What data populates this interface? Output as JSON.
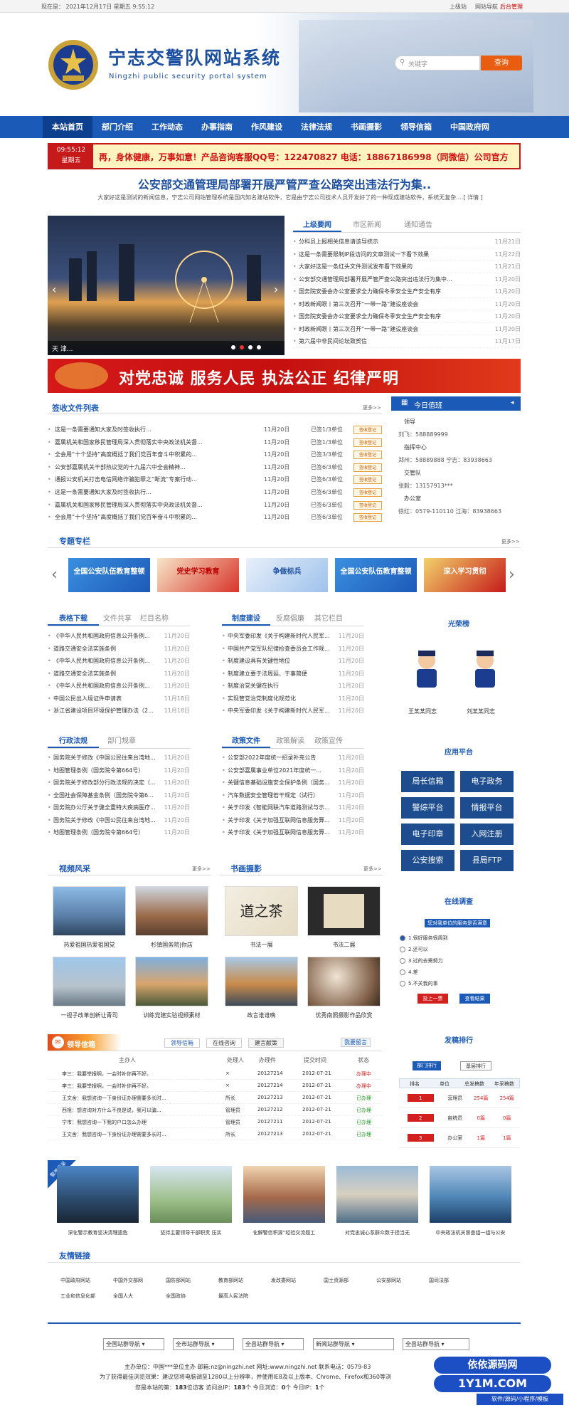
{
  "topbar": {
    "date": "现在是： 2021年12月17日 星期五 9:55:12",
    "links": [
      "上级站",
      "网站导航",
      "后台管理"
    ]
  },
  "header": {
    "title": "宁志交警队网站系统",
    "subtitle": "Ningzhi public security portal system",
    "search_placeholder": "关键字",
    "search_button": "查询"
  },
  "nav": [
    "本站首页",
    "部门介绍",
    "工作动态",
    "办事指南",
    "作风建设",
    "法律法规",
    "书画摄影",
    "领导信箱",
    "中国政府网"
  ],
  "clock": {
    "time": "09:55:12",
    "weekday": "星期五"
  },
  "marquee": "再，身体健康，万事如意！产品咨询客服QQ号：122470827 电话：18867186998（同微信）公司官方",
  "headline": {
    "title": "公安部交通管理局部署开展严管严查公路突出违法行为集..",
    "summary": "大家好这是测试的新闻信息，宁志公司网站管理系统是国内知名建站软件，它是由宁志公司技术人员开发好了的一种现成建站软件，系统无复杂....[ 详情 ]"
  },
  "slider": {
    "caption": "天 津..."
  },
  "news": {
    "tabs": [
      "上级要闻",
      "市区新闻",
      "通知通告"
    ],
    "items": [
      {
        "t": "分科员上报相关信息请该导统示",
        "d": "11月21日"
      },
      {
        "t": "这是一条需要限制IP段访问的文章测试一下看下效果",
        "d": "11月22日"
      },
      {
        "t": "大家好这是一条红头文件测试发布看下效果的",
        "d": "11月21日"
      },
      {
        "t": "公安部交通管理局部署开展严管严查公路突出违法行为集中...",
        "d": "11月20日"
      },
      {
        "t": "国务院安委会办公室要求全力确保冬季安全生产安全有序",
        "d": "11月20日"
      },
      {
        "t": "时政新闻眼丨第三次召开“一带一路”建设座谈会",
        "d": "11月20日"
      },
      {
        "t": "国务院安委会办公室要求全力确保冬季安全生产安全有序",
        "d": "11月20日"
      },
      {
        "t": "时政新闻眼丨第三次召开“一带一路”建设座谈会",
        "d": "11月20日"
      },
      {
        "t": "第六届中非民间论坛致贺信",
        "d": "11月17日"
      }
    ]
  },
  "banner": "对党忠诚  服务人民  执法公正  纪律严明",
  "sign": {
    "title": "签收文件列表",
    "more": "更多>>",
    "items": [
      {
        "t": "这是一条需要通知大家及时签收执行...",
        "d": "11月20日",
        "s": "已签1/3单位",
        "b": "签收登记"
      },
      {
        "t": "嘉属机关和国家移民管理局深入贯彻落实中央政法机关督...",
        "d": "11月20日",
        "s": "已签1/3单位",
        "b": "签收登记"
      },
      {
        "t": "全会用“十个坚持”高度概括了我们党百年奋斗中积累的...",
        "d": "11月20日",
        "s": "已签3/3单位",
        "b": "签收登记"
      },
      {
        "t": "公安部嘉属机关干部热议党的十九届六中全会精神...",
        "d": "11月20日",
        "s": "已签6/3单位",
        "b": "签收登记"
      },
      {
        "t": "通报公安机关打击电信网络诈骗犯罪之“断流”专案行动...",
        "d": "11月20日",
        "s": "已签6/3单位",
        "b": "签收登记"
      },
      {
        "t": "这是一条需要通知大家及时签收执行...",
        "d": "11月20日",
        "s": "已签6/3单位",
        "b": "签收登记"
      },
      {
        "t": "嘉属机关和国家移民管理局深入贯彻落实中央政法机关督...",
        "d": "11月20日",
        "s": "已签6/3单位",
        "b": "签收登记"
      },
      {
        "t": "全会用“十个坚持”高度概括了我们党百年奋斗中积累的...",
        "d": "11月20日",
        "s": "已签6/3单位",
        "b": "签收登记"
      }
    ]
  },
  "duty": {
    "title": "今日值班",
    "lines": [
      "领导",
      "刘飞：588889999",
      "指挥中心",
      "郑州：58889888  宁志：83938663",
      "交管队",
      "张毅：13157913***",
      "办公室",
      "徐红：0579-110110  江海：83938663"
    ]
  },
  "topics": {
    "title": "专题专栏",
    "more": "更多>>",
    "items": [
      "全国公安队伍教育整顿",
      "党史学习教育",
      "争做标兵",
      "全国公安队伍教育整顿",
      "深入学习贯彻"
    ]
  },
  "forms": {
    "tabs": [
      "表格下载",
      "文件共享",
      "栏目名称"
    ],
    "items": [
      {
        "t": "《中华人民共和国政府信息公开条例...",
        "d": "11月20日"
      },
      {
        "t": "道路交通安全法实施条例",
        "d": "11月20日"
      },
      {
        "t": "《中华人民共和国政府信息公开条例...",
        "d": "11月20日"
      },
      {
        "t": "道路交通安全法实施条例",
        "d": "11月20日"
      },
      {
        "t": "《中华人民共和国政府信息公开条例...",
        "d": "11月20日"
      },
      {
        "t": "中国公民出入境证件申请表",
        "d": "11月18日"
      },
      {
        "t": "浙江省建设项目环境保护管理办法（2...",
        "d": "11月18日"
      }
    ]
  },
  "system": {
    "tabs": [
      "制度建设",
      "反腐倡廉",
      "其它栏目"
    ],
    "items": [
      {
        "t": "中央军委印发《关于构建新时代人民军...",
        "d": "11月20日"
      },
      {
        "t": "中国共产党军队纪律检查委员会工作规...",
        "d": "11月20日"
      },
      {
        "t": "制度建设具有关键性地位",
        "d": "11月20日"
      },
      {
        "t": "制度建立要于法周延、于事简便",
        "d": "11月20日"
      },
      {
        "t": "制度治党关键在执行",
        "d": "11月20日"
      },
      {
        "t": "实现管党治党制度化规范化",
        "d": "11月20日"
      },
      {
        "t": "中央军委印发《关于构建新时代人民军...",
        "d": "11月20日"
      }
    ]
  },
  "honor": {
    "title": "光荣榜",
    "people": [
      "王某某同志",
      "刘某某同志"
    ]
  },
  "admin": {
    "tabs": [
      "行政法规",
      "部门规章"
    ],
    "items": [
      {
        "t": "国务院关于修改《中国公民往来台湾地...",
        "d": "11月20日"
      },
      {
        "t": "地图管理条例（国务院令第664号）",
        "d": "11月20日"
      },
      {
        "t": "国务院关于修改部分行政法规的决定（...",
        "d": "11月20日"
      },
      {
        "t": "全国社会保障基金条例（国务院令第6...",
        "d": "11月20日"
      },
      {
        "t": "国务院办公厅关于健全重特大疾病医疗...",
        "d": "11月20日"
      },
      {
        "t": "国务院关于修改《中国公民往来台湾地...",
        "d": "11月20日"
      },
      {
        "t": "地图管理条例（国务院令第664号）",
        "d": "11月20日"
      }
    ]
  },
  "policy": {
    "tabs": [
      "政策文件",
      "政策解读",
      "政策宣传"
    ],
    "items": [
      {
        "t": "公安部2022年度统一招录补充公告",
        "d": "11月20日"
      },
      {
        "t": "公安部嘉属事业单位2021年度统一...",
        "d": "11月20日"
      },
      {
        "t": "关键信息基础设施安全保护条例（国务...",
        "d": "11月20日"
      },
      {
        "t": "汽车数据安全管理若干规定（试行）",
        "d": "11月20日"
      },
      {
        "t": "关于印发《智能网联汽车道路测试与示...",
        "d": "11月20日"
      },
      {
        "t": "关于印发《关于加强互联网信息服务算...",
        "d": "11月20日"
      },
      {
        "t": "关于印发《关于加强互联网信息服务算...",
        "d": "11月20日"
      }
    ]
  },
  "apps": {
    "title": "应用平台",
    "items": [
      "局长信箱",
      "电子政务",
      "警综平台",
      "情报平台",
      "电子印章",
      "入网注册",
      "公安搜索",
      "县局FTP"
    ]
  },
  "videos": {
    "title": "视频风采",
    "more": "更多>>",
    "items": [
      "热爱祖国热爱祖国党",
      "杉镇国务院|你店",
      "一视子改革创新让青司",
      "训练党建实验视频素材"
    ]
  },
  "photos": {
    "title": "书画摄影",
    "more": "更多>>",
    "items": [
      "书法一展",
      "书法二展",
      "政言谁谁晚",
      "优秀南照摄影作品欣赏"
    ]
  },
  "survey": {
    "title": "在线调查",
    "question": "您对我单位的服务是否满意",
    "options": [
      "1.很好服务很周到",
      "2.还可以",
      "3.过的去需努力",
      "4.差",
      "5.不关我的事"
    ],
    "vote": "投上一票",
    "view": "查看结果"
  },
  "mail": {
    "title": "领导信箱",
    "tabs": [
      "领导信箱",
      "在线咨询",
      "建言献策"
    ],
    "write": "我要留言",
    "head": [
      "主办人",
      "处理人",
      "办理件",
      "提交时间",
      "状态"
    ],
    "rows": [
      {
        "t": "李三：我要举报啊，一会时补你再不好。",
        "p": "×",
        "n": "20127214",
        "d": "2012-07-21",
        "s": "办理中",
        "ok": false
      },
      {
        "t": "李三：我要举报啊，一会时补你再不好。",
        "p": "×",
        "n": "20127214",
        "d": "2012-07-21",
        "s": "办理中",
        "ok": false
      },
      {
        "t": "王文舍：我想咨询一下身份证办理需要多长时...",
        "p": "所长",
        "n": "20127213",
        "d": "2012-07-21",
        "s": "已办理",
        "ok": true
      },
      {
        "t": "西祖：想咨询对方什么不良是说，我可以骗...",
        "p": "管理员",
        "n": "20127212",
        "d": "2012-07-21",
        "s": "已办理",
        "ok": true
      },
      {
        "t": "宁市：我想咨询一下我的户口怎么办理",
        "p": "管理员",
        "n": "20127211",
        "d": "2012-07-21",
        "s": "已办理",
        "ok": true
      },
      {
        "t": "王文舍：我想咨询一下身份证办理需要多长时...",
        "p": "所长",
        "n": "20127213",
        "d": "2012-07-21",
        "s": "已办理",
        "ok": true
      }
    ]
  },
  "rank": {
    "title": "发稿排行",
    "tabs": [
      "部门排行",
      "基层排行"
    ],
    "head": [
      "排名",
      "单位",
      "总发稿数",
      "年采稿数"
    ],
    "rows": [
      {
        "r": "1",
        "u": "营理员",
        "a": "254篇",
        "b": "254篇"
      },
      {
        "r": "2",
        "u": "宙统员",
        "a": "0篇",
        "b": "0篇"
      },
      {
        "r": "3",
        "u": "办公室",
        "a": "1篇",
        "b": "1篇"
      }
    ]
  },
  "style_wall": {
    "badge": "警发风采",
    "items": [
      "深化警示教育坚决清理遗危",
      "坚持主要领导干部职责 压实",
      "化解警信积源”经验交流题工",
      "对党忠诚心系群众数于担当无",
      "中央政法机关督查组一组与公安"
    ]
  },
  "links": {
    "title": "友情链接",
    "items": [
      "中国政府网站",
      "中国外交部网",
      "国防部网站",
      "教育部网站",
      "发改委网站",
      "国土资源部",
      "公安部网站",
      "国司法部",
      "工业和信息化部",
      "全国人大",
      "全国政协",
      "最高人民法院"
    ]
  },
  "footer": {
    "selects": [
      "全国站群导航",
      "全市站群导航",
      "全县站群导航",
      "新闻站群导航",
      "全县站群导航"
    ],
    "line1": "主办单位：中国***单位主办  邮箱:nz@ningzhi.net  网址:www.ningzhi.net  联系电话：0579-83",
    "line2": "为了获得最佳浏览效果：建议您将电脑调至1280以上分辨率，并使用IE8及以上版本、Chrome、Firefox和360等浏",
    "stats": [
      "您是本站的第：",
      "183",
      "位访客  访问总IP：",
      "183",
      "个   今日浏览：",
      "0",
      "个  今日IP：",
      "1",
      "个"
    ]
  },
  "watermark": {
    "title": "依依源码网",
    "url": "1Y1M.COM",
    "tag": "软件/源码/小程序/模板"
  }
}
